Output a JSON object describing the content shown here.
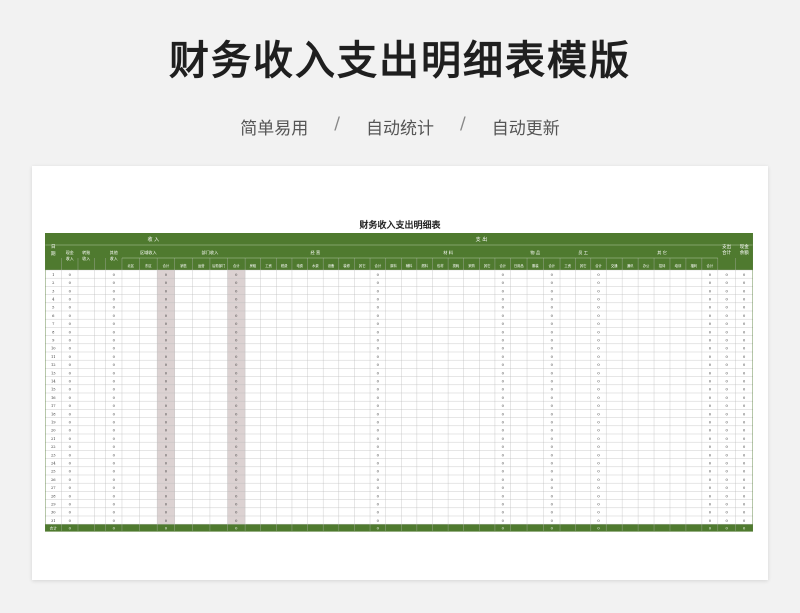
{
  "header": {
    "title": "财务收入支出明细表模版",
    "features": [
      "简单易用",
      "自动统计",
      "自动更新"
    ],
    "separator": "/"
  },
  "sheet": {
    "title": "财务收入支出明细表",
    "colors": {
      "header_bg": "#4f7a2f",
      "header_text": "#ffffff",
      "grid": "#b9b9b9",
      "sum_col_bg": "#dcd2d2",
      "total_row_bg": "#4f7a2f"
    },
    "header_top": {
      "date": "日期",
      "income": "收 入",
      "expense": "支 出",
      "expense_total": "支出合计",
      "cash_balance": "现金余额"
    },
    "header_mid": {
      "cash_income": "现金收入",
      "transfer_income": "转账收入",
      "other_income": "其他收入",
      "region_income": "区域收入",
      "dept_income": "部门收入",
      "operation": "经 营",
      "materials": "材 料",
      "items": "物 品",
      "staff": "员 工",
      "other": "其 它"
    },
    "header_sub": {
      "region": [
        "北区",
        "东区",
        "合计"
      ],
      "dept": [
        "销售",
        "运营",
        "后勤部门",
        "合计"
      ],
      "operation": [
        "房租",
        "工资",
        "税费",
        "电费",
        "水费",
        "设备",
        "装修",
        "其它",
        "合计"
      ],
      "materials": [
        "原料",
        "辅料",
        "燃料",
        "包材",
        "损耗",
        "采购",
        "其它",
        "合计"
      ],
      "items": [
        "日用品",
        "服装",
        "合计"
      ],
      "staff": [
        "工资",
        "其它",
        "合计"
      ],
      "other": [
        "交通",
        "通讯",
        "办公",
        "招待",
        "培训",
        "福利",
        "合计"
      ]
    },
    "days": [
      "1",
      "2",
      "3",
      "4",
      "5",
      "6",
      "7",
      "8",
      "9",
      "10",
      "11",
      "12",
      "13",
      "14",
      "15",
      "16",
      "17",
      "18",
      "19",
      "20",
      "21",
      "22",
      "23",
      "24",
      "25",
      "26",
      "27",
      "28",
      "29",
      "30",
      "31"
    ],
    "zero": "0",
    "total_label": "合计"
  }
}
